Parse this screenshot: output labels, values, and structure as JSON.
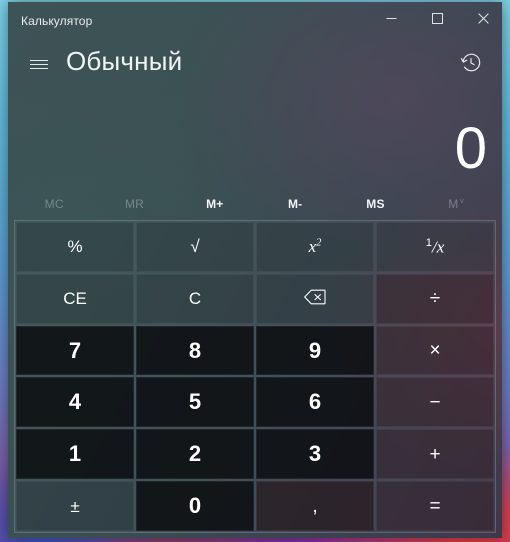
{
  "window": {
    "app_title": "Калькулятор",
    "caption": {
      "minimize": "minimize",
      "maximize": "maximize",
      "close": "close"
    }
  },
  "header": {
    "menu_label": "hamburger-menu",
    "mode_title": "Обычный",
    "history_label": "history"
  },
  "display": {
    "value": "0"
  },
  "memory": {
    "buttons": [
      {
        "label": "MC",
        "enabled": false
      },
      {
        "label": "MR",
        "enabled": false
      },
      {
        "label": "M+",
        "enabled": true
      },
      {
        "label": "M-",
        "enabled": true
      },
      {
        "label": "MS",
        "enabled": true
      },
      {
        "label": "M",
        "enabled": false,
        "chevron": "˅"
      }
    ]
  },
  "keypad": {
    "rows": [
      [
        {
          "name": "percent",
          "label": "%",
          "kind": "fn"
        },
        {
          "name": "square-root",
          "label": "√",
          "kind": "fn"
        },
        {
          "name": "square",
          "label": "x²",
          "kind": "fn"
        },
        {
          "name": "reciprocal",
          "label": "¹/x",
          "kind": "fn"
        }
      ],
      [
        {
          "name": "clear-entry",
          "label": "CE",
          "kind": "fn"
        },
        {
          "name": "clear",
          "label": "C",
          "kind": "fn"
        },
        {
          "name": "backspace",
          "label": "⌫",
          "kind": "fn"
        },
        {
          "name": "divide",
          "label": "÷",
          "kind": "op"
        }
      ],
      [
        {
          "name": "digit-7",
          "label": "7",
          "kind": "num"
        },
        {
          "name": "digit-8",
          "label": "8",
          "kind": "num"
        },
        {
          "name": "digit-9",
          "label": "9",
          "kind": "num"
        },
        {
          "name": "multiply",
          "label": "×",
          "kind": "op"
        }
      ],
      [
        {
          "name": "digit-4",
          "label": "4",
          "kind": "num"
        },
        {
          "name": "digit-5",
          "label": "5",
          "kind": "num"
        },
        {
          "name": "digit-6",
          "label": "6",
          "kind": "num"
        },
        {
          "name": "subtract",
          "label": "−",
          "kind": "op"
        }
      ],
      [
        {
          "name": "digit-1",
          "label": "1",
          "kind": "num"
        },
        {
          "name": "digit-2",
          "label": "2",
          "kind": "num"
        },
        {
          "name": "digit-3",
          "label": "3",
          "kind": "num"
        },
        {
          "name": "add",
          "label": "+",
          "kind": "op"
        }
      ],
      [
        {
          "name": "negate",
          "label": "±",
          "kind": "lite"
        },
        {
          "name": "digit-0",
          "label": "0",
          "kind": "num"
        },
        {
          "name": "decimal-separator",
          "label": ",",
          "kind": "op"
        },
        {
          "name": "equals",
          "label": "=",
          "kind": "op"
        }
      ]
    ]
  },
  "colors": {
    "text": "#ffffff",
    "muted_text": "rgba(225,235,238,0.34)",
    "window_tint": "#3e5356",
    "accent_warm": "#2a161a"
  }
}
